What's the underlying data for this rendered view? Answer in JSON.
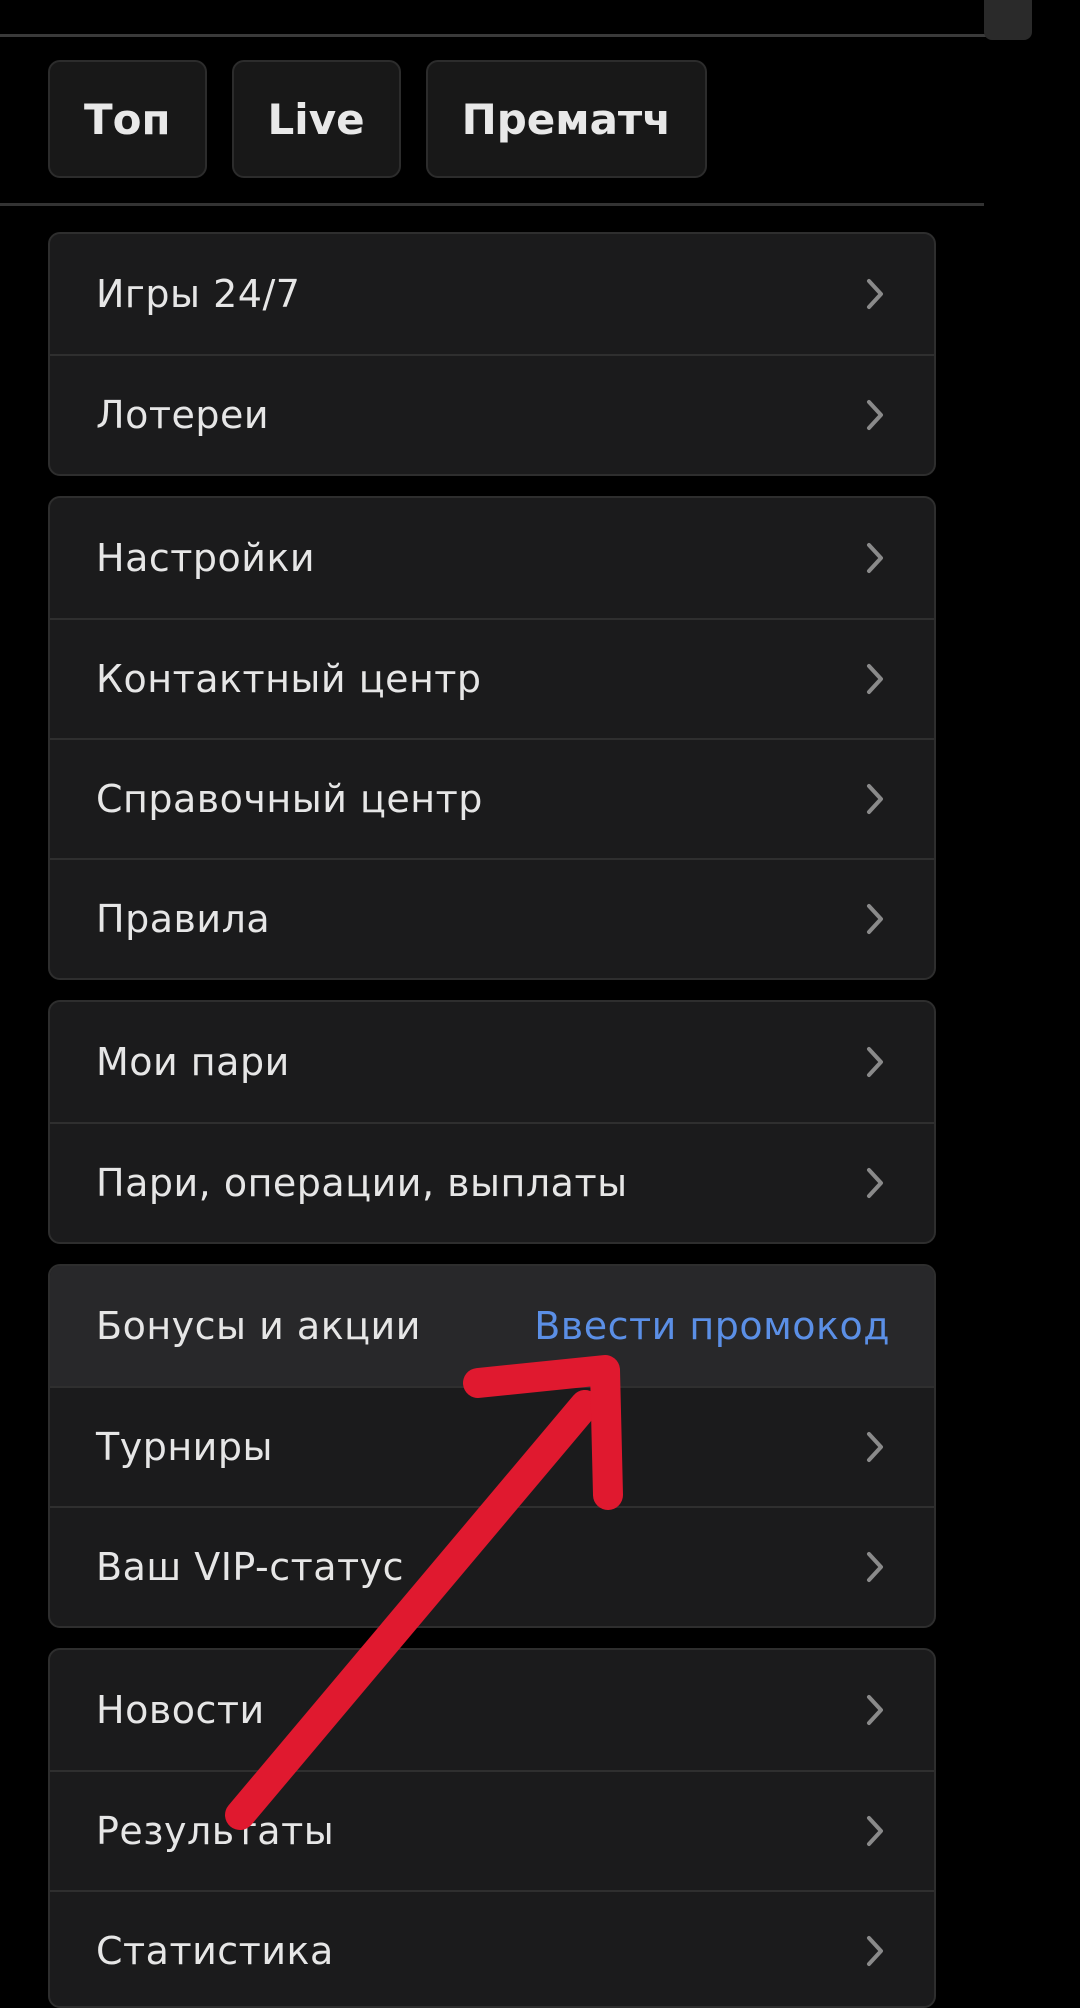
{
  "tabs": [
    "Топ",
    "Live",
    "Прематч"
  ],
  "groups": [
    [
      {
        "label": "Игры 24/7",
        "icon": "chevron-right-icon"
      },
      {
        "label": "Лотереи",
        "icon": "chevron-right-icon"
      }
    ],
    [
      {
        "label": "Настройки",
        "icon": "chevron-right-icon"
      },
      {
        "label": "Контактный центр",
        "icon": "chevron-right-icon"
      },
      {
        "label": "Справочный центр",
        "icon": "chevron-right-icon"
      },
      {
        "label": "Правила",
        "icon": "chevron-right-icon"
      }
    ],
    [
      {
        "label": "Мои пари",
        "icon": "chevron-right-icon"
      },
      {
        "label": "Пари, операции, выплаты",
        "icon": "chevron-right-icon"
      }
    ],
    [
      {
        "label": "Бонусы и акции",
        "link": "Ввести промокод"
      },
      {
        "label": "Турниры",
        "icon": "chevron-right-icon"
      },
      {
        "label": "Ваш VIP-статус",
        "icon": "chevron-right-icon"
      }
    ],
    [
      {
        "label": "Новости",
        "icon": "chevron-right-icon"
      },
      {
        "label": "Результаты",
        "icon": "chevron-right-icon"
      },
      {
        "label": "Статистика",
        "icon": "chevron-right-icon"
      }
    ]
  ],
  "colors": {
    "background": "#000000",
    "panel": "#1b1b1c",
    "link": "#5b8fe6",
    "annotation_arrow": "#e0192f"
  },
  "annotation": {
    "icon": "red-arrow-annotation"
  }
}
